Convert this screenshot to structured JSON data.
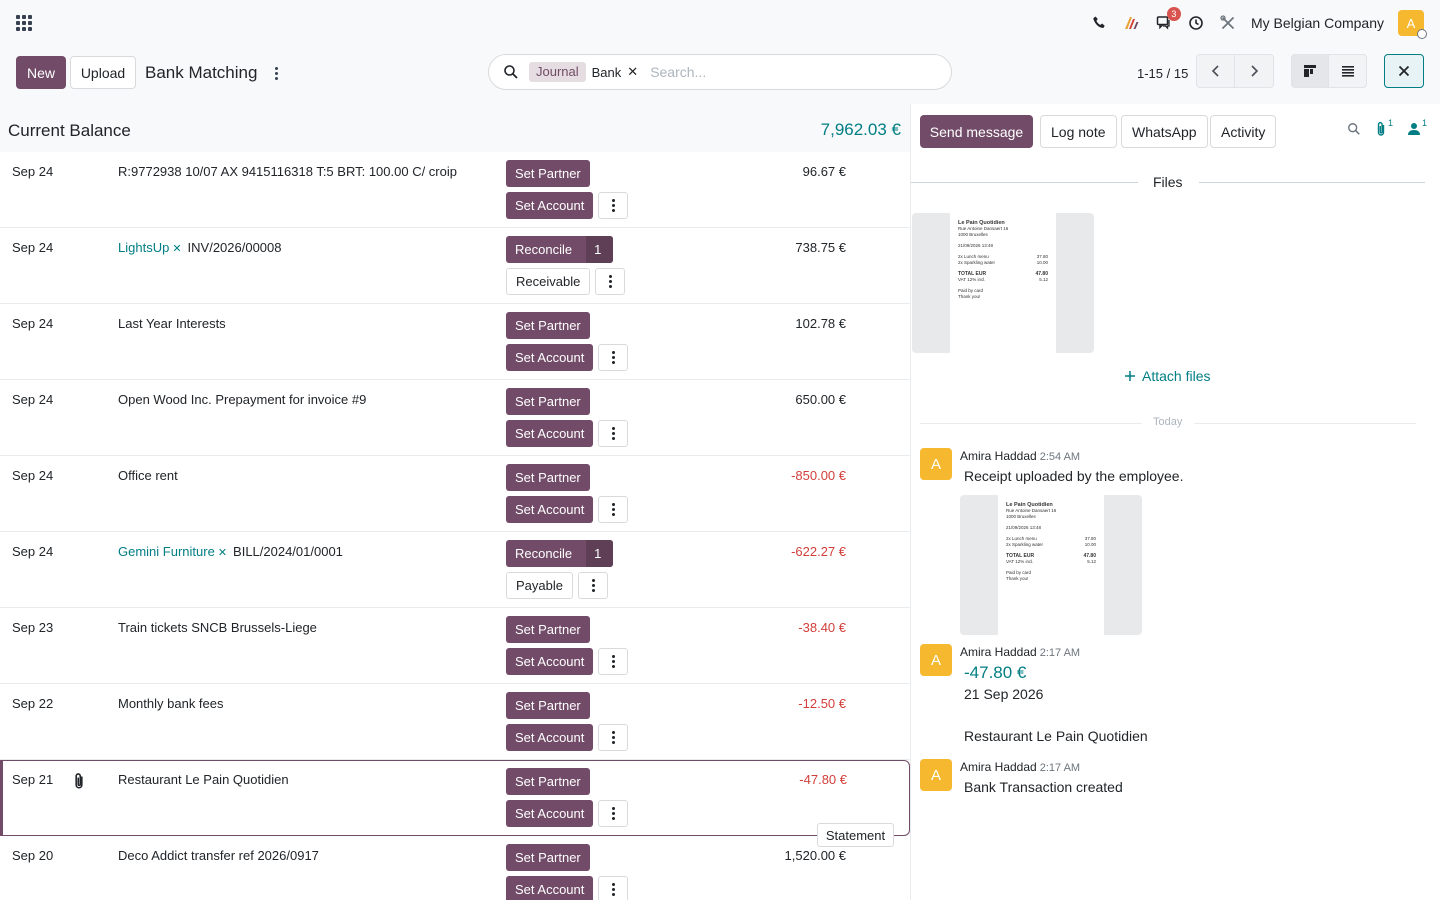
{
  "navbar": {
    "company": "My Belgian Company",
    "user_initial": "A",
    "messages_badge": "3"
  },
  "control_panel": {
    "new_label": "New",
    "upload_label": "Upload",
    "title": "Bank Matching",
    "search": {
      "facet_label": "Journal",
      "facet_value": "Bank",
      "placeholder": "Search..."
    },
    "pager": "1-15 / 15"
  },
  "balance": {
    "label": "Current Balance",
    "value": "7,962.03 €"
  },
  "rows": [
    {
      "date": "Sep 24",
      "partner": "",
      "description": "R:9772938 10/07 AX 9415116318 T:5 BRT: 100.00 C/ croip",
      "btn1": "Set Partner",
      "btn1_count": "",
      "btn2": "Set Account",
      "btn2_light": false,
      "amount": "96.67 €",
      "negative": false,
      "attachment": false
    },
    {
      "date": "Sep 24",
      "partner": "LightsUp",
      "description": "INV/2026/00008",
      "btn1": "Reconcile",
      "btn1_count": "1",
      "btn2": "Receivable",
      "btn2_light": true,
      "amount": "738.75 €",
      "negative": false,
      "attachment": false
    },
    {
      "date": "Sep 24",
      "partner": "",
      "description": "Last Year Interests",
      "btn1": "Set Partner",
      "btn1_count": "",
      "btn2": "Set Account",
      "btn2_light": false,
      "amount": "102.78 €",
      "negative": false,
      "attachment": false
    },
    {
      "date": "Sep 24",
      "partner": "",
      "description": "Open Wood Inc. Prepayment for invoice #9",
      "btn1": "Set Partner",
      "btn1_count": "",
      "btn2": "Set Account",
      "btn2_light": false,
      "amount": "650.00 €",
      "negative": false,
      "attachment": false
    },
    {
      "date": "Sep 24",
      "partner": "",
      "description": "Office rent",
      "btn1": "Set Partner",
      "btn1_count": "",
      "btn2": "Set Account",
      "btn2_light": false,
      "amount": "-850.00 €",
      "negative": true,
      "attachment": false
    },
    {
      "date": "Sep 24",
      "partner": "Gemini Furniture",
      "description": "BILL/2024/01/0001",
      "btn1": "Reconcile",
      "btn1_count": "1",
      "btn2": "Payable",
      "btn2_light": true,
      "amount": "-622.27 €",
      "negative": true,
      "attachment": false
    },
    {
      "date": "Sep 23",
      "partner": "",
      "description": "Train tickets SNCB Brussels-Liege",
      "btn1": "Set Partner",
      "btn1_count": "",
      "btn2": "Set Account",
      "btn2_light": false,
      "amount": "-38.40 €",
      "negative": true,
      "attachment": false
    },
    {
      "date": "Sep 22",
      "partner": "",
      "description": "Monthly bank fees",
      "btn1": "Set Partner",
      "btn1_count": "",
      "btn2": "Set Account",
      "btn2_light": false,
      "amount": "-12.50 €",
      "negative": true,
      "attachment": false
    },
    {
      "date": "Sep 21",
      "partner": "",
      "description": "Restaurant Le Pain Quotidien",
      "btn1": "Set Partner",
      "btn1_count": "",
      "btn2": "Set Account",
      "btn2_light": false,
      "amount": "-47.80 €",
      "negative": true,
      "attachment": true,
      "selected": true
    },
    {
      "date": "Sep 20",
      "partner": "",
      "description": "Deco Addict transfer ref 2026/0917",
      "btn1": "Set Partner",
      "btn1_count": "",
      "btn2": "Set Account",
      "btn2_light": false,
      "amount": "1,520.00 €",
      "negative": false,
      "attachment": false
    }
  ],
  "statement_label": "Statement",
  "chatter": {
    "send_message": "Send message",
    "log_note": "Log note",
    "whatsapp": "WhatsApp",
    "activity": "Activity",
    "attachments_count": "1",
    "followers_count": "1",
    "files_label": "Files",
    "attach_files": "Attach files",
    "today_label": "Today",
    "receipt": {
      "title": "Le Pain Quotidien",
      "address1": "Rue Antoine Dansaert 16",
      "address2": "1000 Bruxelles",
      "datetime": "21/09/2026 13:48",
      "item1": "2x Lunch menu",
      "item1_price": "37.80",
      "item2": "2x Sparkling water",
      "item2_price": "10.00",
      "total_label": "TOTAL EUR",
      "total": "47.80",
      "vat_label": "VAT 12% incl.",
      "vat": "5.12",
      "paid": "Paid by card",
      "thanks": "Thank you!"
    },
    "messages": [
      {
        "author": "Amira Haddad",
        "time": "2:54 AM",
        "body": "Receipt uploaded by the employee.",
        "initial": "A"
      },
      {
        "author": "Amira Haddad",
        "time": "2:17 AM",
        "amount": "-47.80 €",
        "date": "21 Sep 2026",
        "ref": "Restaurant Le Pain Quotidien",
        "initial": "A"
      },
      {
        "author": "Amira Haddad",
        "time": "2:17 AM",
        "body": "Bank Transaction created",
        "initial": "A"
      }
    ]
  },
  "colors": {
    "primary": "#714b67",
    "accent": "#017e84",
    "negative": "#d23f3a",
    "avatar": "#f5b82e"
  },
  "icons": [
    "apps-icon",
    "phone-icon",
    "spreadsheet-icon",
    "chat-icon",
    "clock-icon",
    "tools-icon",
    "search-icon",
    "chevron-left-icon",
    "chevron-right-icon",
    "kanban-view-icon",
    "list-view-icon",
    "close-icon",
    "paperclip-icon",
    "followers-icon",
    "plus-icon"
  ]
}
